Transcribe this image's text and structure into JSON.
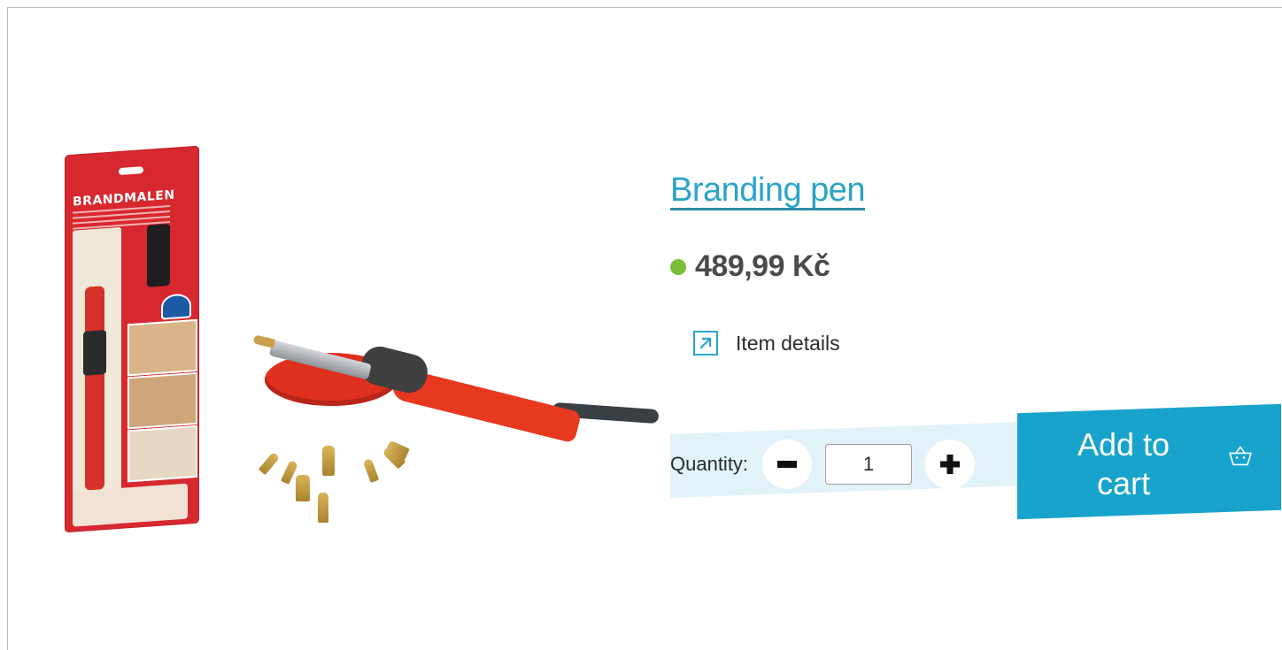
{
  "product": {
    "title": "Branding pen",
    "price": "489,99 Kč",
    "in_stock": true,
    "details_link": "Item details",
    "image_alt_text": "",
    "package_title": "BRANDMALEN"
  },
  "purchase": {
    "quantity_label": "Quantity:",
    "quantity_value": "1",
    "add_to_cart_label": "Add to cart"
  },
  "icons": {
    "stock": "stock-dot-icon",
    "details": "external-link-icon",
    "decrease": "minus-icon",
    "increase": "plus-icon",
    "cart": "basket-icon"
  },
  "colors": {
    "accent": "#17a3cc",
    "title": "#2aa4c8",
    "stock": "#78be3b",
    "price": "#4a4a4a",
    "quantity_strip": "#e2f2f9",
    "frame_border": "#b9bcbf"
  }
}
